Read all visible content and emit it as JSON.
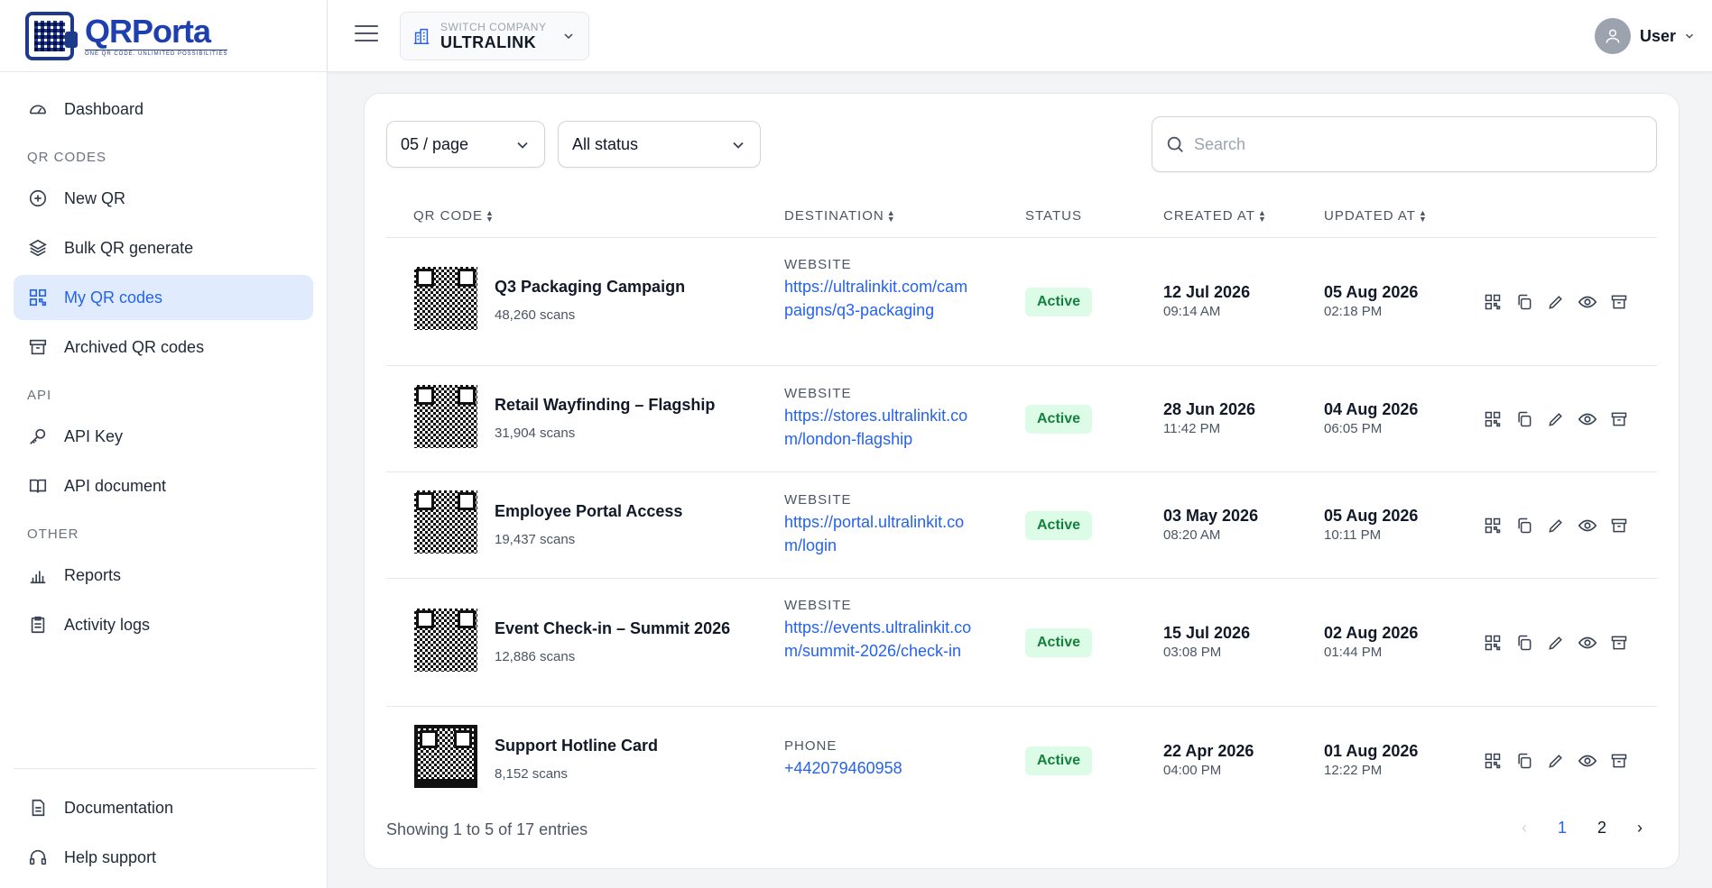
{
  "app": {
    "name": "QRPorta",
    "tagline": "ONE QR CODE. UNLIMITED POSSIBILITIES"
  },
  "sidebar": {
    "dashboard": "Dashboard",
    "section_qr": "QR CODES",
    "new_qr": "New QR",
    "bulk": "Bulk QR generate",
    "my_qr": "My QR codes",
    "archived": "Archived QR codes",
    "section_api": "API",
    "api_key": "API Key",
    "api_doc": "API document",
    "section_other": "OTHER",
    "reports": "Reports",
    "activity": "Activity logs",
    "documentation": "Documentation",
    "help": "Help support"
  },
  "topbar": {
    "company_label": "SWITCH COMPANY",
    "company_value": "ULTRALINK",
    "user_name": "User"
  },
  "filters": {
    "page_size": "05 / page",
    "status": "All status",
    "search_placeholder": "Search"
  },
  "table": {
    "headers": {
      "qr_code": "QR CODE",
      "destination": "DESTINATION",
      "status": "STATUS",
      "created": "CREATED AT",
      "updated": "UPDATED AT"
    },
    "rows": [
      {
        "name": "Q3 Packaging Campaign",
        "scans": "48,260 scans",
        "dest_type": "WEBSITE",
        "dest": "https://ultralinkit.com/campaigns/q3-packaging",
        "status": "Active",
        "created_date": "12 Jul 2026",
        "created_time": "09:14 AM",
        "updated_date": "05 Aug 2026",
        "updated_time": "02:18 PM"
      },
      {
        "name": "Retail Wayfinding – Flagship",
        "scans": "31,904 scans",
        "dest_type": "WEBSITE",
        "dest": "https://stores.ultralinkit.com/london-flagship",
        "status": "Active",
        "created_date": "28 Jun 2026",
        "created_time": "11:42 PM",
        "updated_date": "04 Aug 2026",
        "updated_time": "06:05 PM"
      },
      {
        "name": "Employee Portal Access",
        "scans": "19,437 scans",
        "dest_type": "WEBSITE",
        "dest": "https://portal.ultralinkit.com/login",
        "status": "Active",
        "created_date": "03 May 2026",
        "created_time": "08:20 AM",
        "updated_date": "05 Aug 2026",
        "updated_time": "10:11 PM"
      },
      {
        "name": "Event Check-in – Summit 2026",
        "scans": "12,886 scans",
        "dest_type": "WEBSITE",
        "dest": "https://events.ultralinkit.com/summit-2026/check-in",
        "status": "Active",
        "created_date": "15 Jul 2026",
        "created_time": "03:08 PM",
        "updated_date": "02 Aug 2026",
        "updated_time": "01:44 PM"
      },
      {
        "name": "Support Hotline Card",
        "scans": "8,152 scans",
        "dest_type": "PHONE",
        "dest": "+442079460958",
        "status": "Active",
        "created_date": "22 Apr 2026",
        "created_time": "04:00 PM",
        "updated_date": "01 Aug 2026",
        "updated_time": "12:22 PM"
      }
    ]
  },
  "footer": {
    "info": "Showing 1 to 5 of 17 entries",
    "prev": "‹",
    "page1": "1",
    "page2": "2",
    "next": "›"
  },
  "colors": {
    "accent": "#2563eb",
    "active_bg": "#dcfce7",
    "active_text": "#15803d",
    "nav_active_bg": "#e0ecfe"
  }
}
